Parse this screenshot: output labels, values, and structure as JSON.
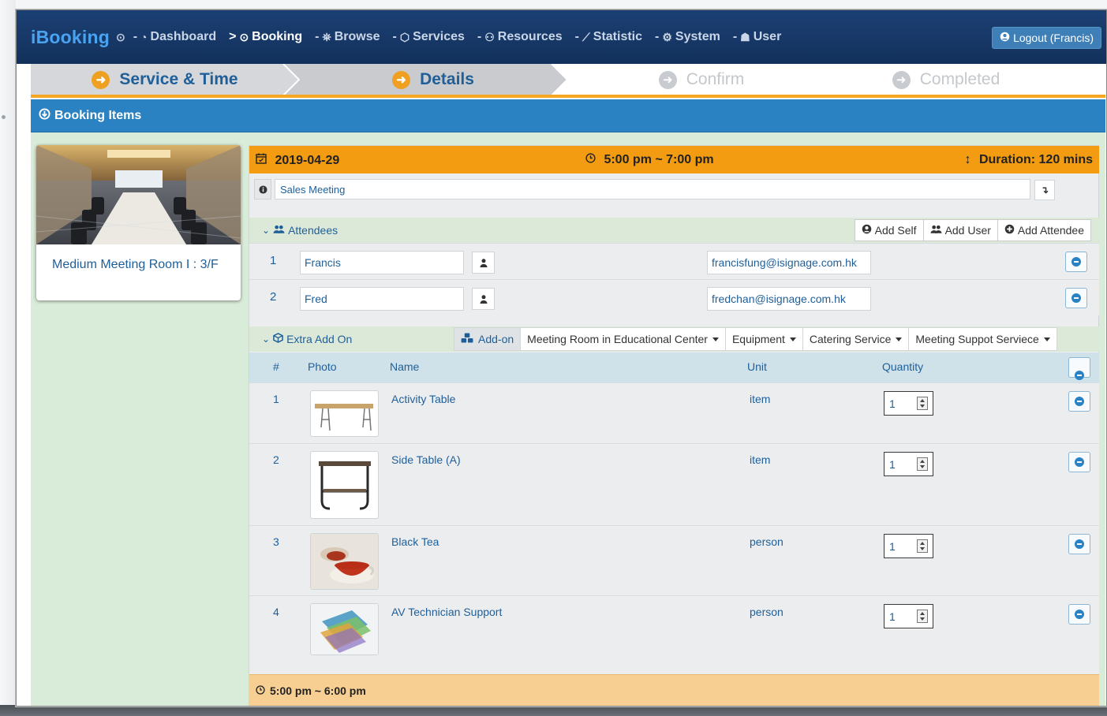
{
  "nav": {
    "brand": "iBooking",
    "brand_icon": "⊙",
    "items": [
      {
        "dash": "-",
        "icon": "◔",
        "label": "Dashboard"
      },
      {
        "dash": ">",
        "icon": "⊙",
        "label": "Booking"
      },
      {
        "dash": "-",
        "icon": "⛯",
        "label": "Browse"
      },
      {
        "dash": "-",
        "icon": "⬡",
        "label": "Services"
      },
      {
        "dash": "-",
        "icon": "⚇",
        "label": "Resources"
      },
      {
        "dash": "-",
        "icon": "⟋",
        "label": "Statistic"
      },
      {
        "dash": "-",
        "icon": "⚙",
        "label": "System"
      },
      {
        "dash": "-",
        "icon": "☗",
        "label": "User"
      }
    ],
    "logout": "Logout (Francis)"
  },
  "steps": [
    {
      "label": "Service & Time",
      "state": "done"
    },
    {
      "label": "Details",
      "state": "done"
    },
    {
      "label": "Confirm",
      "state": "todo"
    },
    {
      "label": "Completed",
      "state": "todo"
    }
  ],
  "panel": {
    "title": "Booking Items"
  },
  "room": {
    "name": "Medium Meeting Room I : 3/F"
  },
  "booking": {
    "date": "2019-04-29",
    "time": "5:00 pm ~ 7:00 pm",
    "duration": "Duration: 120 mins",
    "title_value": "Sales Meeting"
  },
  "attendees": {
    "heading": "Attendees",
    "buttons": {
      "add_self": "Add Self",
      "add_user": "Add User",
      "add_attendee": "Add Attendee"
    },
    "rows": [
      {
        "num": "1",
        "name": "Francis",
        "email": "francisfung@isignage.com.hk"
      },
      {
        "num": "2",
        "name": "Fred",
        "email": "fredchan@isignage.com.hk"
      }
    ]
  },
  "addon": {
    "heading": "Extra Add On",
    "dropdowns": {
      "addon": "Add-on",
      "room": "Meeting Room in Educational Center",
      "equipment": "Equipment",
      "catering": "Catering Service",
      "support": "Meeting Suppot Serviece"
    },
    "columns": {
      "num": "#",
      "photo": "Photo",
      "name": "Name",
      "unit": "Unit",
      "quantity": "Quantity"
    },
    "items": [
      {
        "num": "1",
        "name": "Activity Table",
        "unit": "item",
        "qty": "1"
      },
      {
        "num": "2",
        "name": "Side Table (A)",
        "unit": "item",
        "qty": "1"
      },
      {
        "num": "3",
        "name": "Black Tea",
        "unit": "person",
        "qty": "1"
      },
      {
        "num": "4",
        "name": "AV Technician Support",
        "unit": "person",
        "qty": "1"
      }
    ]
  },
  "next_slot": {
    "time": "5:00 pm ~ 6:00 pm"
  }
}
